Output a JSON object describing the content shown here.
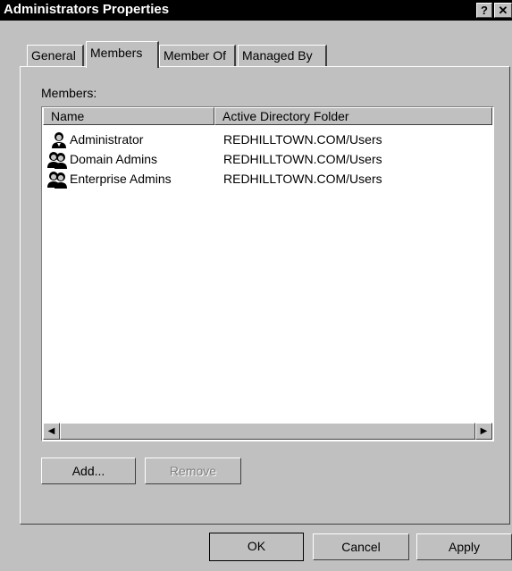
{
  "window": {
    "title": "Administrators Properties",
    "help_label": "?",
    "close_label": "✕"
  },
  "tabs": [
    {
      "label": "General"
    },
    {
      "label": "Members"
    },
    {
      "label": "Member Of"
    },
    {
      "label": "Managed By"
    }
  ],
  "members": {
    "section_label": "Members:",
    "columns": [
      "Name",
      "Active Directory Folder"
    ],
    "rows": [
      {
        "name": "Administrator",
        "folder": "REDHILLTOWN.COM/Users",
        "icon": "user-icon"
      },
      {
        "name": "Domain Admins",
        "folder": "REDHILLTOWN.COM/Users",
        "icon": "group-icon"
      },
      {
        "name": "Enterprise Admins",
        "folder": "REDHILLTOWN.COM/Users",
        "icon": "group-icon"
      }
    ],
    "scroll_left": "◀",
    "scroll_right": "▶"
  },
  "buttons": {
    "add": "Add...",
    "remove": "Remove",
    "ok": "OK",
    "cancel": "Cancel",
    "apply": "Apply"
  }
}
